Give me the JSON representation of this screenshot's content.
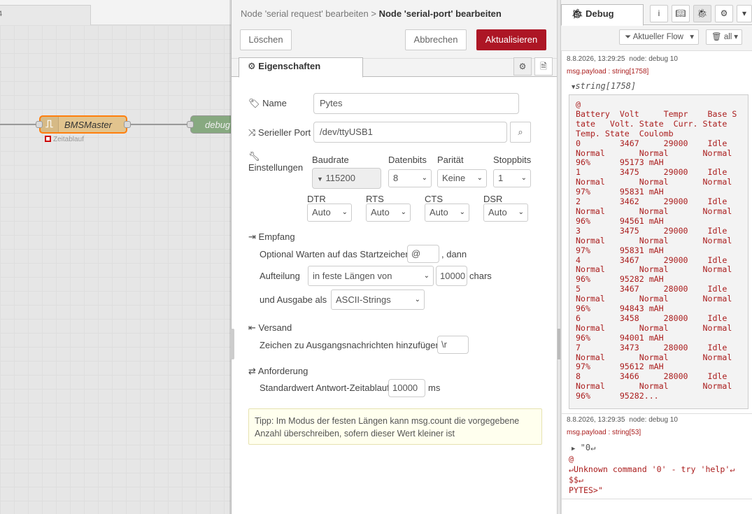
{
  "workspace": {
    "tab_label": "4",
    "nodes": [
      {
        "id": "bms",
        "label": "BMSMaster",
        "status": "Zeitablauf",
        "icon": "serial-wave-icon"
      },
      {
        "id": "debug",
        "label": "debug",
        "icon": "debug-icon"
      }
    ]
  },
  "tray": {
    "breadcrumb_parent": "Node 'serial request' bearbeiten",
    "breadcrumb_sep": ">",
    "breadcrumb_current": "Node 'serial-port' bearbeiten",
    "buttons": {
      "delete": "Löschen",
      "cancel": "Abbrechen",
      "update": "Aktualisieren"
    },
    "tab_properties": "Eigenschaften",
    "name_label": "Name",
    "name_value": "Pytes",
    "port_label": "Serieller Port",
    "port_value": "/dev/ttyUSB1",
    "settings_label": "Einstellungen",
    "baud_label": "Baudrate",
    "baud_value": "115200",
    "databits_label": "Datenbits",
    "databits_value": "8",
    "parity_label": "Parität",
    "parity_value": "Keine",
    "stopbits_label": "Stoppbits",
    "stopbits_value": "1",
    "dtr_label": "DTR",
    "dtr_value": "Auto",
    "rts_label": "RTS",
    "rts_value": "Auto",
    "cts_label": "CTS",
    "cts_value": "Auto",
    "dsr_label": "DSR",
    "dsr_value": "Auto",
    "input_section": "Empfang",
    "wait_label": "Optional Warten auf das Startzeichen",
    "wait_value": "@",
    "wait_suffix": ", dann",
    "split_label": "Aufteilung",
    "split_value": "in feste Längen von",
    "split_len_value": "10000",
    "split_suffix": "chars",
    "output_label": "und Ausgabe als",
    "output_value": "ASCII-Strings",
    "output_section": "Versand",
    "add_char_label": "Zeichen zu Ausgangsnachrichten hinzufügen",
    "add_char_value": "\\r",
    "request_section": "Anforderung",
    "timeout_label": "Standardwert Antwort-Zeitablauf",
    "timeout_value": "10000",
    "timeout_unit": "ms",
    "tip": "Tipp: Im Modus der festen Längen kann msg.count die vorgegebene Anzahl überschreiben, sofern dieser Wert kleiner ist"
  },
  "sidebar": {
    "tab_label": "Debug",
    "filter_label": "Aktueller Flow",
    "clear_label": "all",
    "messages": [
      {
        "time": "8.8.2026, 13:29:25",
        "node": "node: debug 10",
        "path": "msg.payload : string[1758]",
        "type": "string[1758]",
        "body": "@\nBattery  Volt     Tempr    Base S\ntate   Volt. State  Curr. State\nTemp. State  Coulomb\n0        3467     29000    Idle\nNormal       Normal       Normal\n96%      95173 mAH\n1        3475     29000    Idle\nNormal       Normal       Normal\n97%      95831 mAH\n2        3462     29000    Idle\nNormal       Normal       Normal\n96%      94561 mAH\n3        3475     29000    Idle\nNormal       Normal       Normal\n97%      95831 mAH\n4        3467     29000    Idle\nNormal       Normal       Normal\n96%      95282 mAH\n5        3467     28000    Idle\nNormal       Normal       Normal\n96%      94843 mAH\n6        3458     28000    Idle\nNormal       Normal       Normal\n96%      94001 mAH\n7        3473     28000    Idle\nNormal       Normal       Normal\n97%      95612 mAH\n8        3466     28000    Idle\nNormal       Normal       Normal\n96%      95282..."
      },
      {
        "time": "8.8.2026, 13:29:35",
        "node": "node: debug 10",
        "path": "msg.payload : string[53]",
        "line1": "\"0↵",
        "body": "@\n↵Unknown command '0' - try 'help'↵\n$$↵\nPYTES>\""
      }
    ]
  }
}
